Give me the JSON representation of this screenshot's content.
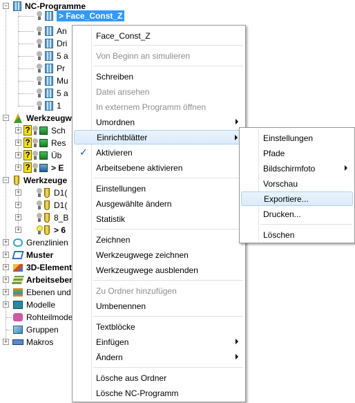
{
  "tree": {
    "nc_programs": {
      "label": "NC-Programme",
      "children": [
        "> Face_Const_Z",
        "An",
        "Dri",
        "5 a",
        "Pr",
        "Mu",
        "5 a",
        "1"
      ]
    },
    "toolpaths": {
      "label": "Werkzeugw",
      "children": [
        "Sch",
        "Res",
        "Üb",
        "> E"
      ]
    },
    "tools": {
      "label": "Werkzeuge",
      "children": [
        "D1(",
        "D1(",
        "8_B",
        "> 6"
      ]
    },
    "other": [
      "Grenzlinien",
      "Muster",
      "3D-Element",
      "Arbeitseben",
      "Ebenen und",
      "Modelle",
      "Rohteilmode",
      "Gruppen",
      "Makros"
    ]
  },
  "context_menu": {
    "header": "Face_Const_Z",
    "items": [
      "Von Beginn an simulieren",
      "Schreiben",
      "Datei ansehen",
      "In externem Programm öffnen",
      "Umordnen",
      "Einrichtblätter",
      "Aktivieren",
      "Arbeitsebene aktivieren",
      "Einstellungen",
      "Ausgewählte ändern",
      "Statistik",
      "Zeichnen",
      "Werkzeugwege zeichnen",
      "Werkzeugwege ausblenden",
      "Zu Ordner hinzufügen",
      "Umbenennen",
      "Textblöcke",
      "Einfügen",
      "Ändern",
      "Lösche aus Ordner",
      "Lösche NC-Programm"
    ],
    "check_mark": "✓"
  },
  "submenu": {
    "items": [
      "Einstellungen",
      "Pfade",
      "Bildschirmfoto",
      "Vorschau",
      "Exportiere...",
      "Drucken...",
      "Löschen"
    ]
  }
}
